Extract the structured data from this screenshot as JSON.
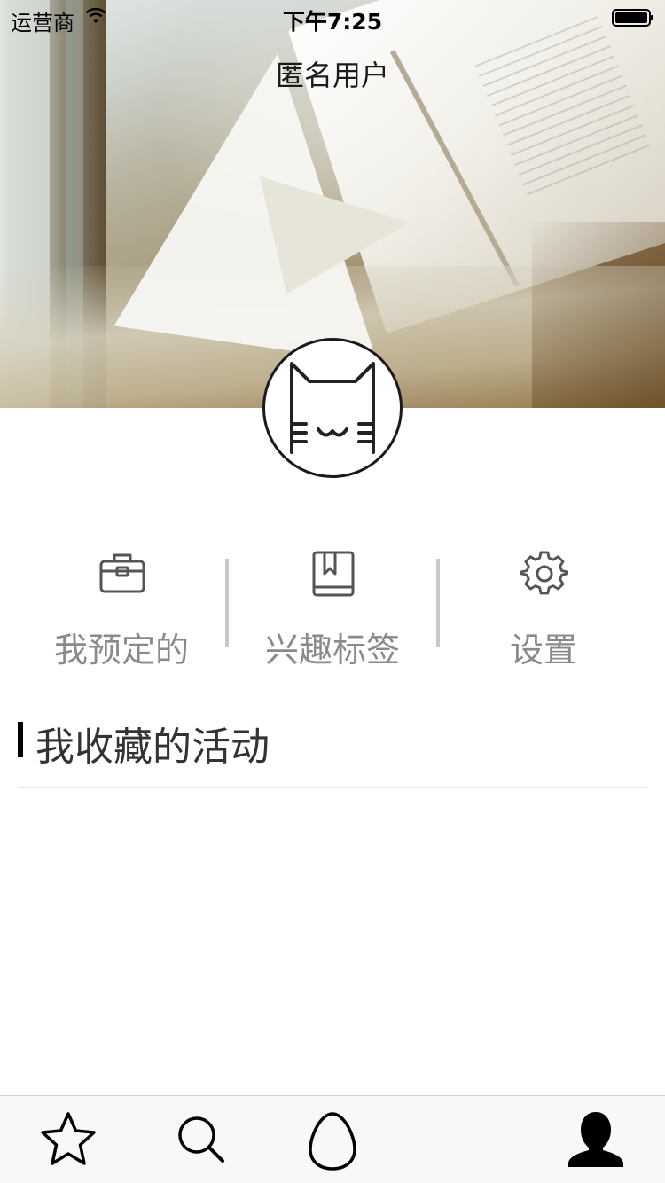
{
  "status_bar": {
    "carrier": "运营商",
    "time": "下午7:25"
  },
  "header": {
    "title": "匿名用户",
    "avatar_icon": "cat-face-icon"
  },
  "menu": [
    {
      "label": "我预定的",
      "icon": "briefcase-icon"
    },
    {
      "label": "兴趣标签",
      "icon": "bookmark-book-icon"
    },
    {
      "label": "设置",
      "icon": "gear-icon"
    }
  ],
  "section": {
    "title": "我收藏的活动"
  },
  "tab_bar": [
    {
      "icon": "star-icon"
    },
    {
      "icon": "search-icon"
    },
    {
      "icon": "egg-icon"
    },
    {
      "icon": "user-icon",
      "selected": true
    }
  ]
}
